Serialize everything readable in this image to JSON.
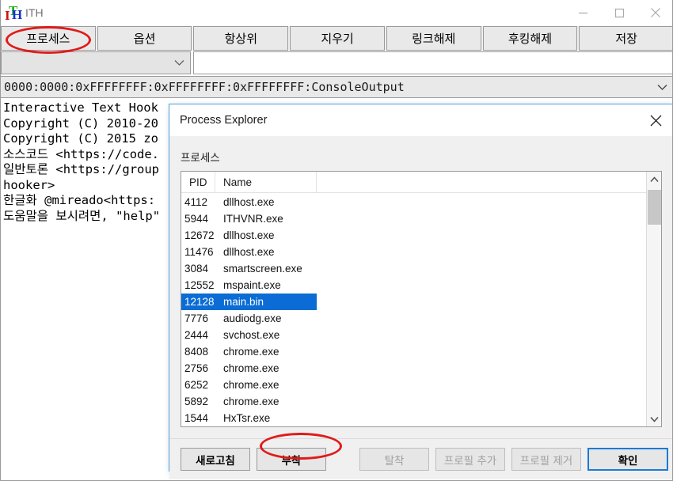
{
  "window": {
    "logo_letters": {
      "i": "I",
      "t": "T",
      "h": "H"
    },
    "app_name": "ITH",
    "controls": {
      "minimize": "minimize-icon",
      "maximize": "maximize-icon",
      "close": "close-icon"
    }
  },
  "toolbar": {
    "buttons": [
      {
        "label": "프로세스",
        "name": "process-button"
      },
      {
        "label": "옵션",
        "name": "options-button"
      },
      {
        "label": "항상위",
        "name": "always-on-top-button"
      },
      {
        "label": "지우기",
        "name": "clear-button"
      },
      {
        "label": "링크해제",
        "name": "unlink-button"
      },
      {
        "label": "후킹해제",
        "name": "unhook-button"
      },
      {
        "label": "저장",
        "name": "save-button"
      }
    ]
  },
  "thread_row": {
    "combo_value": "",
    "combo_chevron": "⌄",
    "input_value": "",
    "input_placeholder": ""
  },
  "status": {
    "text": "0000:0000:0xFFFFFFFF:0xFFFFFFFF:0xFFFFFFFF:ConsoleOutput",
    "chevron": "⌄"
  },
  "console": {
    "lines": [
      "Interactive Text Hook",
      "Copyright (C) 2010-20",
      "Copyright (C) 2015 zo",
      "소스코드 <https://code.",
      "일반토론 <https://group",
      "hooker>",
      "한글화 @mireado<https:",
      "도움말을 보시려면, \"help\""
    ]
  },
  "dialog": {
    "title": "Process Explorer",
    "close_icon": "close-icon",
    "section_label": "프로세스",
    "columns": [
      "PID",
      "Name"
    ],
    "processes": [
      {
        "pid": "4112",
        "name": "dllhost.exe",
        "selected": false
      },
      {
        "pid": "5944",
        "name": "ITHVNR.exe",
        "selected": false
      },
      {
        "pid": "12672",
        "name": "dllhost.exe",
        "selected": false
      },
      {
        "pid": "11476",
        "name": "dllhost.exe",
        "selected": false
      },
      {
        "pid": "3084",
        "name": "smartscreen.exe",
        "selected": false
      },
      {
        "pid": "12552",
        "name": "mspaint.exe",
        "selected": false
      },
      {
        "pid": "12128",
        "name": "main.bin",
        "selected": true
      },
      {
        "pid": "7776",
        "name": "audiodg.exe",
        "selected": false
      },
      {
        "pid": "2444",
        "name": "svchost.exe",
        "selected": false
      },
      {
        "pid": "8408",
        "name": "chrome.exe",
        "selected": false
      },
      {
        "pid": "2756",
        "name": "chrome.exe",
        "selected": false
      },
      {
        "pid": "6252",
        "name": "chrome.exe",
        "selected": false
      },
      {
        "pid": "5892",
        "name": "chrome.exe",
        "selected": false
      },
      {
        "pid": "1544",
        "name": "HxTsr.exe",
        "selected": false
      }
    ],
    "scrollbar": {
      "up": "⌃",
      "down": "⌄"
    },
    "footer_buttons": [
      {
        "label": "새로고침",
        "name": "refresh-button",
        "disabled": false,
        "primary": false
      },
      {
        "label": "부착",
        "name": "attach-button",
        "disabled": false,
        "primary": false
      },
      {
        "label": "탈착",
        "name": "detach-button",
        "disabled": true,
        "primary": false
      },
      {
        "label": "프로필 추가",
        "name": "add-profile-button",
        "disabled": true,
        "primary": false
      },
      {
        "label": "프로필 제거",
        "name": "remove-profile-button",
        "disabled": true,
        "primary": false
      },
      {
        "label": "확인",
        "name": "ok-button",
        "disabled": false,
        "primary": true
      }
    ]
  },
  "annotations": {
    "ellipse_process": "red-ellipse-around-process-button",
    "ellipse_attach": "red-ellipse-around-attach-button",
    "color": "#e01b1b"
  }
}
